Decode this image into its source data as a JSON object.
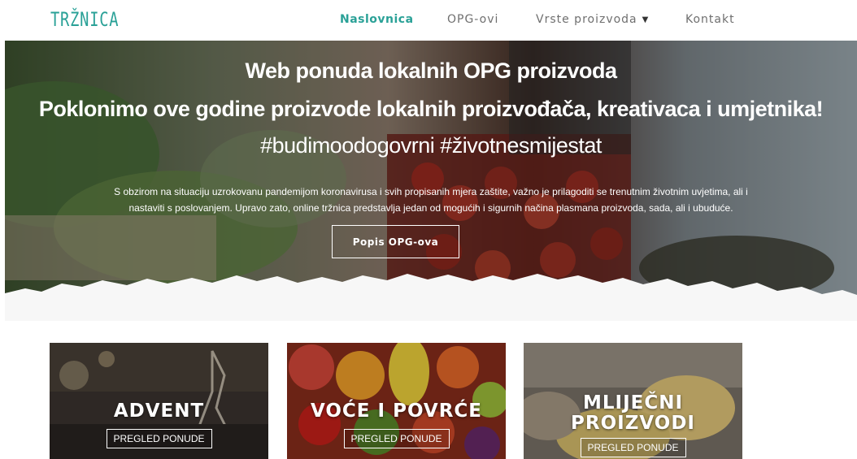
{
  "header": {
    "logo": "TRŽNICA",
    "nav": [
      {
        "label": "Naslovnica",
        "active": true
      },
      {
        "label": "OPG-ovi",
        "active": false
      },
      {
        "label": "Vrste proizvoda",
        "active": false,
        "dropdown": true
      },
      {
        "label": "Kontakt",
        "active": false
      }
    ]
  },
  "hero": {
    "title": "Web ponuda lokalnih OPG proizvoda",
    "subtitle": "Poklonimo ove godine proizvode lokalnih proizvođača, kreativaca i umjetnika!",
    "hashtags": "#budimoodogovrni #životnesmijestat",
    "body_line_1": "S obzirom na situaciju uzrokovanu pandemijom koronavirusa i svih propisanih mjera zaštite, važno je prilagoditi se trenutnim životnim uvjetima, ali i",
    "body_line_2": "nastaviti s poslovanjem. Upravo zato, online tržnica predstavlja jedan od mogućih i sigurnih načina plasmana proizvoda, sada, ali i ubuduće.",
    "button_label": "Popis OPG-ova"
  },
  "cards": [
    {
      "title_line_1": "ADVENT",
      "title_line_2": "",
      "button_label": "PREGLED PONUDE"
    },
    {
      "title_line_1": "VOĆE I POVRĆE",
      "title_line_2": "",
      "button_label": "PREGLED PONUDE"
    },
    {
      "title_line_1": "MLIJEČNI",
      "title_line_2": "PROIZVODI",
      "button_label": "PREGLED PONUDE"
    }
  ],
  "colors": {
    "brand": "#2aa197",
    "nav_text": "#6f6f6f",
    "page_background": "#ffffff"
  }
}
